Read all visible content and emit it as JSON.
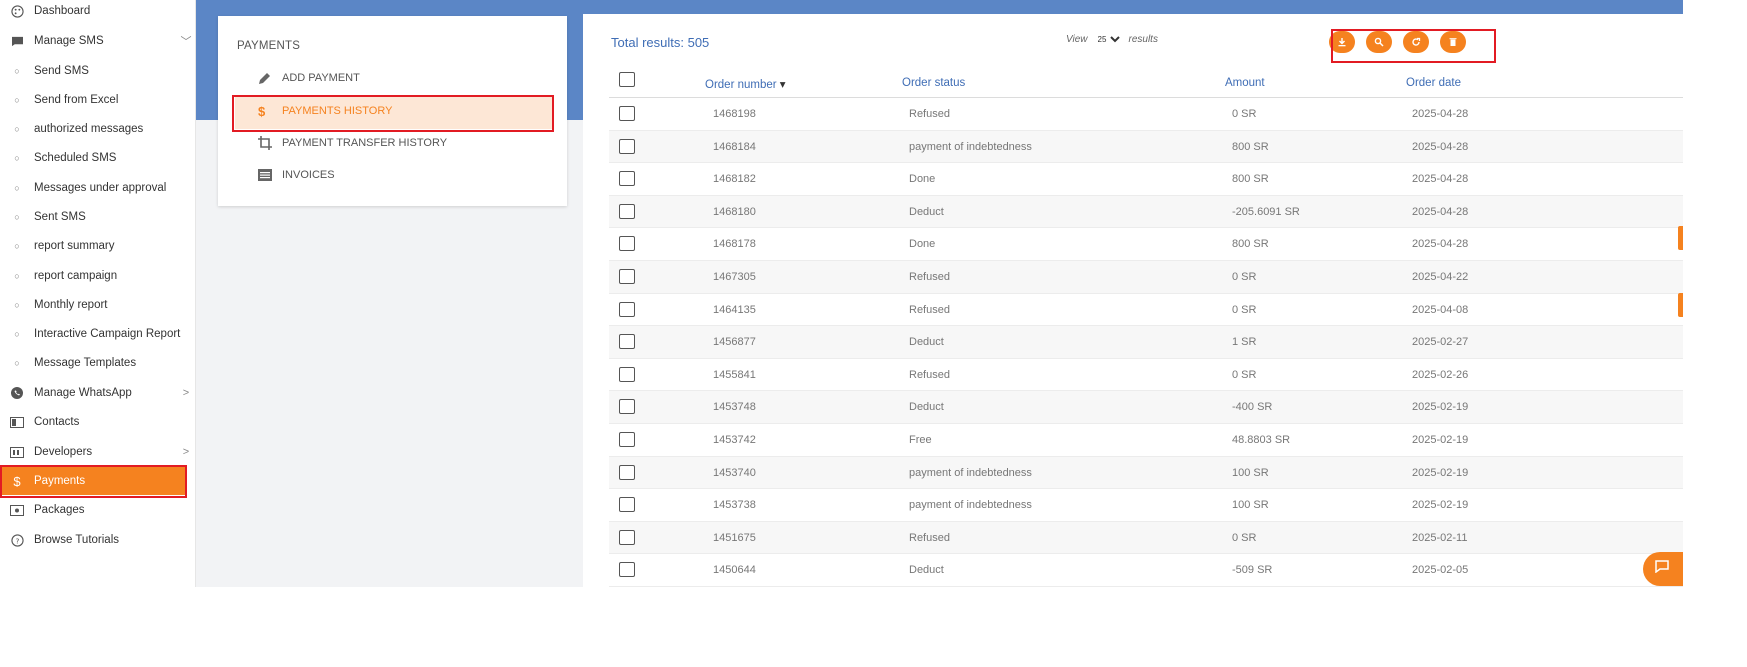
{
  "sidebar": {
    "items": [
      {
        "label": "Dashboard",
        "icon": "palette-icon"
      },
      {
        "label": "Manage SMS",
        "icon": "message-icon",
        "chevron": "﹀"
      },
      {
        "label": "Send SMS",
        "icon": "bullet-icon"
      },
      {
        "label": "Send from Excel",
        "icon": "bullet-icon"
      },
      {
        "label": "authorized messages",
        "icon": "bullet-icon"
      },
      {
        "label": "Scheduled SMS",
        "icon": "bullet-icon"
      },
      {
        "label": "Messages under approval",
        "icon": "bullet-icon"
      },
      {
        "label": "Sent SMS",
        "icon": "bullet-icon"
      },
      {
        "label": "report summary",
        "icon": "bullet-icon"
      },
      {
        "label": "report campaign",
        "icon": "bullet-icon"
      },
      {
        "label": "Monthly report",
        "icon": "bullet-icon"
      },
      {
        "label": "Interactive Campaign Report",
        "icon": "bullet-icon"
      },
      {
        "label": "Message Templates",
        "icon": "bullet-icon"
      },
      {
        "label": "Manage WhatsApp",
        "icon": "whatsapp-icon",
        "chevron": ">"
      },
      {
        "label": "Contacts",
        "icon": "contacts-icon"
      },
      {
        "label": "Developers",
        "icon": "developers-icon",
        "chevron": ">"
      },
      {
        "label": "Payments",
        "icon": "dollar-icon"
      },
      {
        "label": "Packages",
        "icon": "packages-icon"
      },
      {
        "label": "Browse Tutorials",
        "icon": "help-icon"
      }
    ]
  },
  "payments_menu": {
    "title": "PAYMENTS",
    "items": [
      {
        "label": "ADD PAYMENT",
        "icon": "pencil-icon"
      },
      {
        "label": "PAYMENTS HISTORY",
        "icon": "dollar-icon"
      },
      {
        "label": "PAYMENT TRANSFER HISTORY",
        "icon": "crop-icon"
      },
      {
        "label": "INVOICES",
        "icon": "list-icon"
      }
    ]
  },
  "results": {
    "total_label": "Total results: 505",
    "view_prefix": "View",
    "view_value": "25",
    "view_suffix": "results"
  },
  "toolbar": {
    "icons": [
      "download-icon",
      "search-icon",
      "refresh-icon",
      "delete-icon"
    ]
  },
  "table": {
    "columns": [
      "Order number",
      "Order status",
      "Amount",
      "Order date"
    ],
    "sort_indicator": "▾",
    "rows": [
      [
        "1468198",
        "Refused",
        "0 SR",
        "2025-04-28"
      ],
      [
        "1468184",
        "payment of indebtedness",
        "800 SR",
        "2025-04-28"
      ],
      [
        "1468182",
        "Done",
        "800 SR",
        "2025-04-28"
      ],
      [
        "1468180",
        "Deduct",
        "-205.6091 SR",
        "2025-04-28"
      ],
      [
        "1468178",
        "Done",
        "800 SR",
        "2025-04-28"
      ],
      [
        "1467305",
        "Refused",
        "0 SR",
        "2025-04-22"
      ],
      [
        "1464135",
        "Refused",
        "0 SR",
        "2025-04-08"
      ],
      [
        "1456877",
        "Deduct",
        "1 SR",
        "2025-02-27"
      ],
      [
        "1455841",
        "Refused",
        "0 SR",
        "2025-02-26"
      ],
      [
        "1453748",
        "Deduct",
        "-400 SR",
        "2025-02-19"
      ],
      [
        "1453742",
        "Free",
        "48.8803 SR",
        "2025-02-19"
      ],
      [
        "1453740",
        "payment of indebtedness",
        "100 SR",
        "2025-02-19"
      ],
      [
        "1453738",
        "payment of indebtedness",
        "100 SR",
        "2025-02-19"
      ],
      [
        "1451675",
        "Refused",
        "0 SR",
        "2025-02-11"
      ],
      [
        "1450644",
        "Deduct",
        "-509 SR",
        "2025-02-05"
      ]
    ]
  },
  "colors": {
    "accent": "#f5821f",
    "header_blue": "#5b86c6",
    "link_blue": "#3f6db5",
    "highlight_red": "#e21b23"
  }
}
